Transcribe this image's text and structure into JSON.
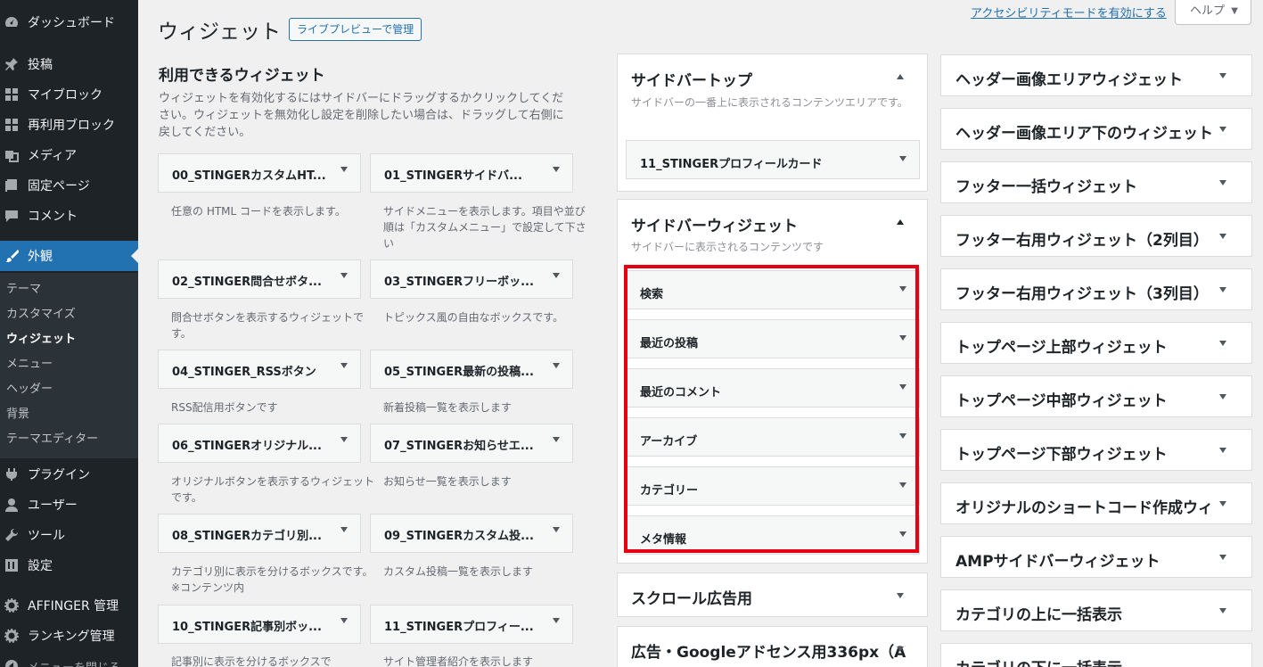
{
  "sidebar": {
    "items": [
      {
        "label": "ダッシュボード",
        "icon": "dashboard-icon"
      },
      {
        "label": "投稿",
        "icon": "pin-icon"
      },
      {
        "label": "マイブロック",
        "icon": "grid-icon"
      },
      {
        "label": "再利用ブロック",
        "icon": "grid-icon"
      },
      {
        "label": "メディア",
        "icon": "media-icon"
      },
      {
        "label": "固定ページ",
        "icon": "page-icon"
      },
      {
        "label": "コメント",
        "icon": "comment-icon"
      },
      {
        "label": "外観",
        "icon": "brush-icon"
      },
      {
        "label": "プラグイン",
        "icon": "plugin-icon"
      },
      {
        "label": "ユーザー",
        "icon": "user-icon"
      },
      {
        "label": "ツール",
        "icon": "wrench-icon"
      },
      {
        "label": "設定",
        "icon": "settings-icon"
      },
      {
        "label": "AFFINGER 管理",
        "icon": "gear-icon"
      },
      {
        "label": "ランキング管理",
        "icon": "gear-icon"
      },
      {
        "label": "メニューを閉じる",
        "icon": "collapse-icon"
      }
    ],
    "submenu": [
      "テーマ",
      "カスタマイズ",
      "ウィジェット",
      "メニュー",
      "ヘッダー",
      "背景",
      "テーマエディター"
    ]
  },
  "header": {
    "title": "ウィジェット",
    "live_preview": "ライブプレビューで管理",
    "a11y_link": "アクセシビリティモードを有効にする",
    "help": "ヘルプ"
  },
  "available": {
    "title": "利用できるウィジェット",
    "desc": "ウィジェットを有効化するにはサイドバーにドラッグするかクリックしてください。ウィジェットを無効化し設定を削除したい場合は、ドラッグして右側に戻してください。",
    "widgets": [
      {
        "name": "00_STINGERカスタムHT...",
        "desc": "任意の HTML コードを表示します。"
      },
      {
        "name": "01_STINGERサイドバ...",
        "desc": "サイドメニューを表示します。項目や並び順は「カスタムメニュー」で設定して下さい"
      },
      {
        "name": "02_STINGER問合せボタ...",
        "desc": "問合せボタンを表示するウィジェットです。"
      },
      {
        "name": "03_STINGERフリーボッ...",
        "desc": "トピックス風の自由なボックスです。"
      },
      {
        "name": "04_STINGER_RSSボタン",
        "desc": "RSS配信用ボタンです"
      },
      {
        "name": "05_STINGER最新の投稿...",
        "desc": "新着投稿一覧を表示します"
      },
      {
        "name": "06_STINGERオリジナル...",
        "desc": "オリジナルボタンを表示するウィジェットです。"
      },
      {
        "name": "07_STINGERお知らせエ...",
        "desc": "お知らせ一覧を表示します"
      },
      {
        "name": "08_STINGERカテゴリ別...",
        "desc": "カテゴリ別に表示を分けるボックスです。※コンテンツ内"
      },
      {
        "name": "09_STINGERカスタム投...",
        "desc": "カスタム投稿一覧を表示します"
      },
      {
        "name": "10_STINGER記事別ボッ...",
        "desc": "記事別に表示を分けるボックスで"
      },
      {
        "name": "11_STINGERプロフィー...",
        "desc": "サイト管理者紹介を表示します"
      }
    ]
  },
  "areas": {
    "top": {
      "title": "サイドバートップ",
      "desc": "サイドバーの一番上に表示されるコンテンツエリアです。",
      "widgets": [
        "11_STINGERプロフィールカード"
      ]
    },
    "main": {
      "title": "サイドバーウィジェット",
      "desc": "サイドバーに表示されるコンテンツです",
      "widgets": [
        "検索",
        "最近の投稿",
        "最近のコメント",
        "アーカイブ",
        "カテゴリー",
        "メタ情報"
      ]
    },
    "scroll": {
      "title": "スクロール広告用"
    },
    "ad": {
      "title": "広告・Googleアドセンス用336px（A"
    }
  },
  "right_areas": [
    "ヘッダー画像エリアウィジェット",
    "ヘッダー画像エリア下のウィジェット",
    "フッター一括ウィジェット",
    "フッター右用ウィジェット（2列目）",
    "フッター右用ウィジェット（3列目）",
    "トップページ上部ウィジェット",
    "トップページ中部ウィジェット",
    "トップページ下部ウィジェット",
    "オリジナルのショートコード作成ウィ",
    "AMPサイドバーウィジェット",
    "カテゴリの上に一括表示",
    "カテゴリの下に一括表示"
  ],
  "colors": {
    "accent": "#2271b1",
    "highlight": "#e60012",
    "sidebar_bg": "#1d2327"
  }
}
